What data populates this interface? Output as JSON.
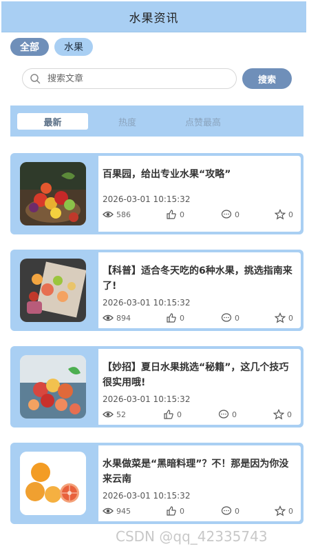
{
  "header": {
    "title": "水果资讯"
  },
  "categories": [
    {
      "label": "全部"
    },
    {
      "label": "水果"
    }
  ],
  "search": {
    "placeholder": "搜索文章",
    "button_label": "搜索"
  },
  "tabs": [
    {
      "label": "最新"
    },
    {
      "label": "热度"
    },
    {
      "label": "点赞最高"
    }
  ],
  "articles": [
    {
      "title": "百果园，给出专业水果“攻略”",
      "time": "2026-03-01 10:15:32",
      "views": "586",
      "likes": "0",
      "comments": "0",
      "favorites": "0"
    },
    {
      "title": "【科普】适合冬天吃的6种水果，挑选指南来了!",
      "time": "2026-03-01 10:15:32",
      "views": "894",
      "likes": "0",
      "comments": "0",
      "favorites": "0"
    },
    {
      "title": "【妙招】夏日水果挑选“秘籍”，这几个技巧很实用哦!",
      "time": "2026-03-01 10:15:32",
      "views": "52",
      "likes": "0",
      "comments": "0",
      "favorites": "0"
    },
    {
      "title": "水果做菜是“黑暗料理”？不！那是因为你没来云南",
      "time": "2026-03-01 10:15:32",
      "views": "945",
      "likes": "0",
      "comments": "0",
      "favorites": "0"
    }
  ],
  "watermark": "CSDN @qq_42335743",
  "colors": {
    "header_bg": "#a9cff3",
    "chip_active": "#6f8fb9",
    "card_bg": "#a9cff3"
  },
  "icons": [
    "search-icon",
    "eye-icon",
    "thumbs-up-icon",
    "comment-icon",
    "star-icon"
  ]
}
